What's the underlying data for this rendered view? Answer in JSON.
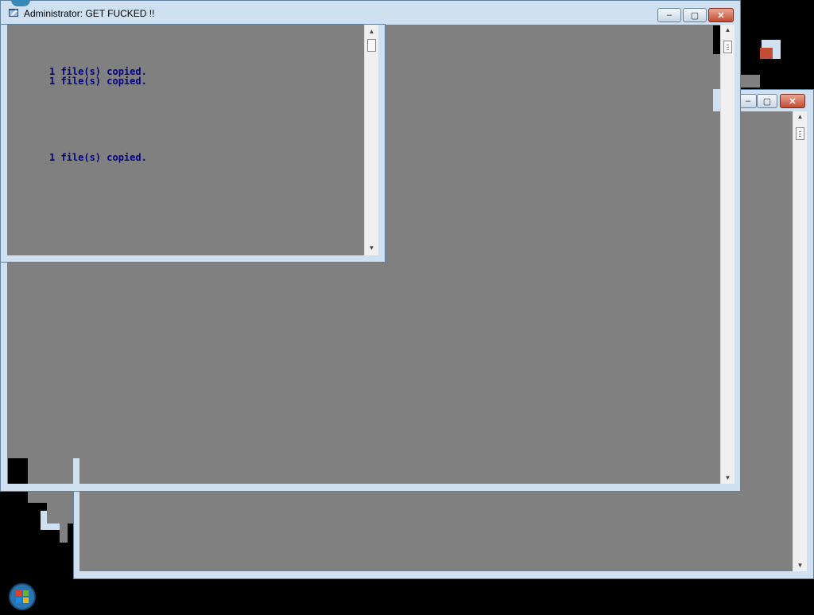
{
  "windows": {
    "main": {
      "title": "Administrator:  GET FUCKED !!",
      "lines": [
        "1 file(s) copied.",
        "1 file(s) copied.",
        "1 file(s) copied."
      ]
    }
  },
  "buttons": {
    "minimize": "–",
    "maximize": "▢",
    "close": "✕"
  },
  "scroll": {
    "up": "▲",
    "down": "▼"
  },
  "colors": {
    "console_bg": "#808080",
    "console_text": "#000080",
    "frame": "#cfe0f0",
    "close_button": "#c44b33"
  }
}
